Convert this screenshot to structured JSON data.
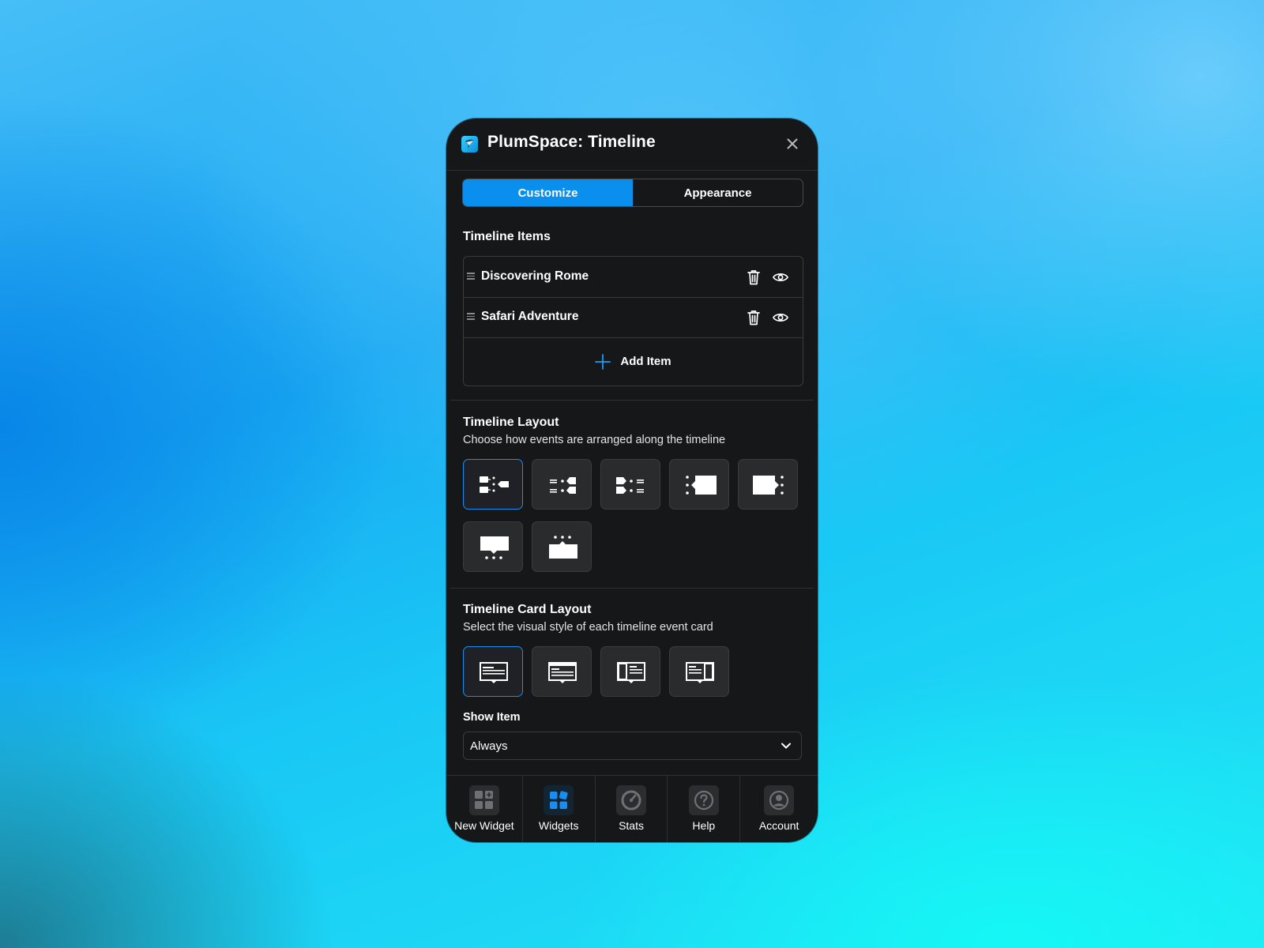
{
  "window": {
    "title": "PlumSpace: Timeline"
  },
  "tabs": [
    {
      "label": "Customize",
      "active": true
    },
    {
      "label": "Appearance",
      "active": false
    }
  ],
  "timeline_items": {
    "title": "Timeline Items",
    "items": [
      {
        "label": "Discovering Rome"
      },
      {
        "label": "Safari Adventure"
      }
    ],
    "add_label": "Add Item"
  },
  "timeline_layout": {
    "title": "Timeline Layout",
    "subtitle": "Choose how events are arranged along the timeline",
    "selected_index": 0
  },
  "card_layout": {
    "title": "Timeline Card Layout",
    "subtitle": "Select the visual style of each timeline event card",
    "selected_index": 0
  },
  "show_item": {
    "label": "Show Item",
    "value": "Always"
  },
  "bottom_nav": [
    {
      "label": "New Widget",
      "icon": "new-widget-icon",
      "active": false
    },
    {
      "label": "Widgets",
      "icon": "widgets-icon",
      "active": true
    },
    {
      "label": "Stats",
      "icon": "stats-gauge-icon",
      "active": false
    },
    {
      "label": "Help",
      "icon": "help-icon",
      "active": false
    },
    {
      "label": "Account",
      "icon": "account-icon",
      "active": false
    }
  ],
  "colors": {
    "accent": "#0a8fee",
    "panel_bg": "#161718",
    "tile_bg": "#2a2b2d"
  }
}
